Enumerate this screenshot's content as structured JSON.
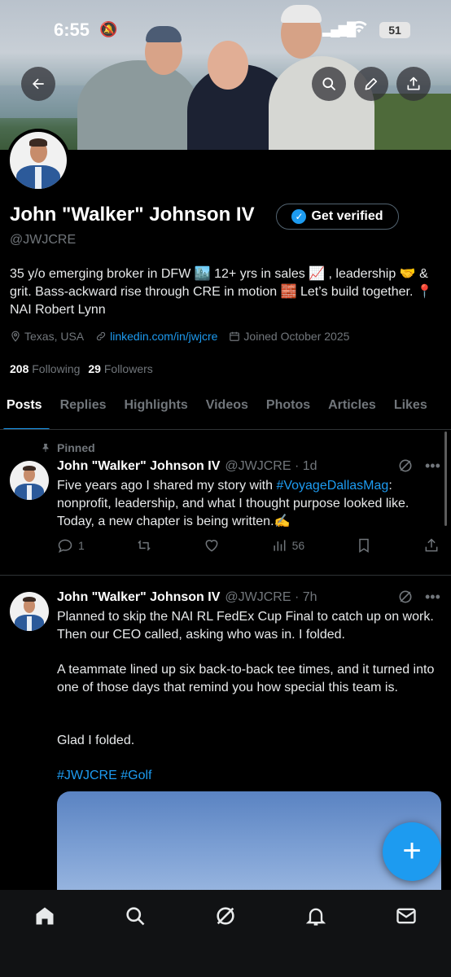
{
  "status_bar": {
    "time": "6:55",
    "battery": "51"
  },
  "profile": {
    "name": "John \"Walker\" Johnson IV",
    "handle": "@JWJCRE",
    "verify_label": "Get verified",
    "bio": "35 y/o emerging broker in DFW 🏙️ 12+ yrs in sales 📈 , leadership 🤝 & grit. Bass-ackward rise through CRE in motion 🧱 Let’s build together. 📍 NAI Robert Lynn",
    "location": "Texas, USA",
    "website": "linkedin.com/in/jwjcre",
    "joined": "Joined October 2025",
    "following_count": "208",
    "following_label": "Following",
    "followers_count": "29",
    "followers_label": "Followers"
  },
  "tabs": [
    "Posts",
    "Replies",
    "Highlights",
    "Videos",
    "Photos",
    "Articles",
    "Likes"
  ],
  "posts": [
    {
      "pinned_label": "Pinned",
      "name": "John \"Walker\" Johnson IV",
      "handle_time": "@JWJCRE · 1d",
      "text_before": "Five years ago I shared my story with ",
      "hashtag": "#VoyageDallasMag",
      "text_after": ": nonprofit, leadership, and what I thought purpose looked like. Today, a new chapter is being written.✍️",
      "replies": "1",
      "views": "56"
    },
    {
      "name": "John \"Walker\" Johnson IV",
      "handle_time": "@JWJCRE · 7h",
      "paragraph1": "Planned to skip the NAI RL FedEx Cup Final to catch up on work. Then our CEO called, asking who was in. I folded.",
      "paragraph2": "A teammate lined up six back-to-back tee times, and it turned into one of those days that remind you how special this team is.",
      "paragraph3": "Glad I folded.",
      "hashtags": "#JWJCRE #Golf"
    }
  ],
  "fab_label": "+",
  "colors": {
    "accent": "#1d9bf0",
    "background": "#000000",
    "muted": "#71767b"
  }
}
